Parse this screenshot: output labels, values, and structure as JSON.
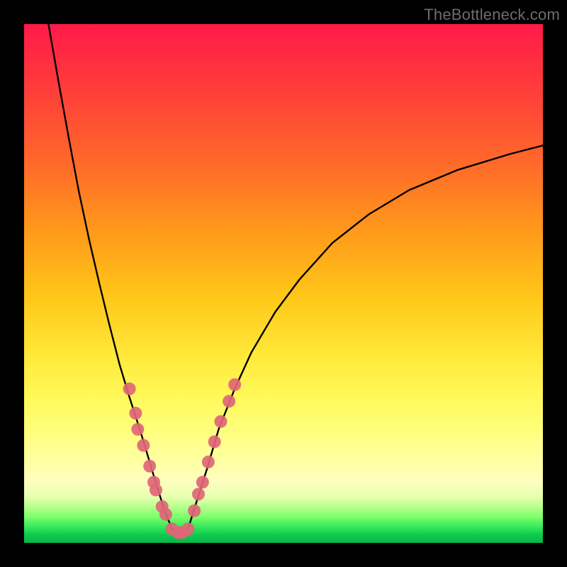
{
  "watermark": "TheBottleneck.com",
  "chart_data": {
    "type": "line",
    "title": "",
    "xlabel": "",
    "ylabel": "",
    "xlim": [
      0,
      100
    ],
    "ylim": [
      0,
      100
    ],
    "grid": false,
    "legend": false,
    "gradient_stops": [
      {
        "pos": 0.0,
        "color": "#ff1a49"
      },
      {
        "pos": 0.12,
        "color": "#ff3b3b"
      },
      {
        "pos": 0.27,
        "color": "#ff6a2a"
      },
      {
        "pos": 0.4,
        "color": "#ff9a1a"
      },
      {
        "pos": 0.53,
        "color": "#ffc81a"
      },
      {
        "pos": 0.64,
        "color": "#ffe93a"
      },
      {
        "pos": 0.72,
        "color": "#fff95a"
      },
      {
        "pos": 0.78,
        "color": "#ffff7a"
      },
      {
        "pos": 0.83,
        "color": "#ffff9a"
      },
      {
        "pos": 0.88,
        "color": "#ffffbf"
      },
      {
        "pos": 0.91,
        "color": "#e8ffb0"
      },
      {
        "pos": 0.93,
        "color": "#b8ff8e"
      },
      {
        "pos": 0.95,
        "color": "#7cff6a"
      },
      {
        "pos": 0.97,
        "color": "#32e85a"
      },
      {
        "pos": 0.985,
        "color": "#0fc94f"
      },
      {
        "pos": 1.0,
        "color": "#07b845"
      }
    ],
    "series": [
      {
        "name": "curve-left",
        "x": [
          4.7,
          6.6,
          8.6,
          10.5,
          12.5,
          14.5,
          16.4,
          18.4,
          20.3,
          22.3,
          24.2,
          25.6,
          27.1,
          28.5
        ],
        "y": [
          100,
          89.1,
          78.1,
          68.0,
          58.6,
          50.0,
          42.2,
          34.4,
          28.1,
          21.9,
          15.6,
          10.9,
          6.2,
          2.7
        ]
      },
      {
        "name": "curve-right",
        "x": [
          31.6,
          33.2,
          35.2,
          37.5,
          40.6,
          43.8,
          48.4,
          53.1,
          59.4,
          66.4,
          74.2,
          83.6,
          93.8,
          100
        ],
        "y": [
          2.7,
          7.8,
          14.1,
          21.9,
          29.7,
          36.7,
          44.5,
          50.8,
          57.8,
          63.3,
          68.0,
          71.9,
          75.0,
          76.6
        ]
      },
      {
        "name": "floor",
        "x": [
          28.5,
          31.6
        ],
        "y": [
          2.7,
          2.7
        ]
      }
    ],
    "markers": [
      {
        "x": 20.3,
        "y": 29.7
      },
      {
        "x": 21.5,
        "y": 25.0
      },
      {
        "x": 21.9,
        "y": 21.9
      },
      {
        "x": 23.0,
        "y": 18.8
      },
      {
        "x": 24.2,
        "y": 14.8
      },
      {
        "x": 25.0,
        "y": 11.7
      },
      {
        "x": 25.4,
        "y": 10.2
      },
      {
        "x": 26.6,
        "y": 7.0
      },
      {
        "x": 27.3,
        "y": 5.5
      },
      {
        "x": 28.5,
        "y": 2.7
      },
      {
        "x": 29.7,
        "y": 2.0
      },
      {
        "x": 30.5,
        "y": 2.0
      },
      {
        "x": 31.6,
        "y": 2.7
      },
      {
        "x": 32.8,
        "y": 6.2
      },
      {
        "x": 33.6,
        "y": 9.4
      },
      {
        "x": 34.4,
        "y": 11.7
      },
      {
        "x": 35.5,
        "y": 15.6
      },
      {
        "x": 36.7,
        "y": 19.5
      },
      {
        "x": 37.9,
        "y": 23.4
      },
      {
        "x": 39.5,
        "y": 27.3
      },
      {
        "x": 40.6,
        "y": 30.5
      }
    ],
    "marker_style": {
      "shape": "circle",
      "radius_px": 9,
      "fill": "#e06677",
      "opacity": 0.92
    }
  }
}
